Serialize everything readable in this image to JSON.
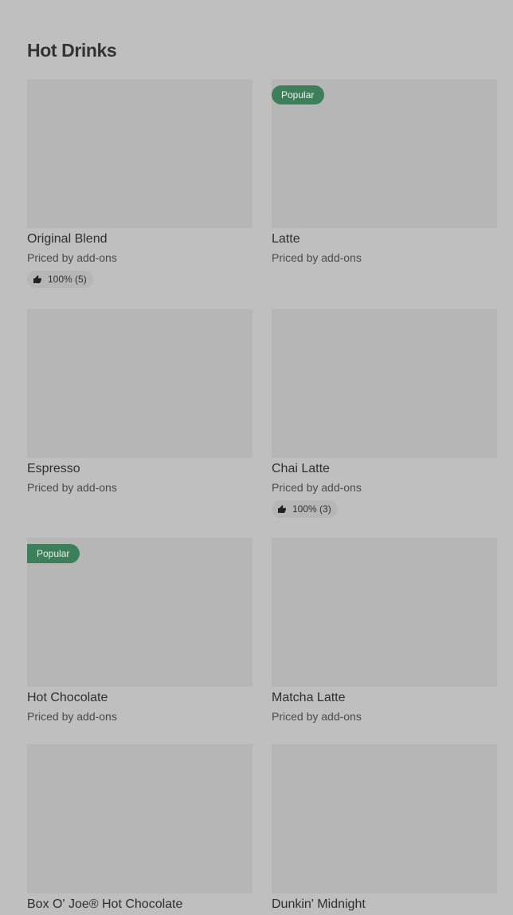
{
  "section": {
    "title": "Hot Drinks"
  },
  "items": [
    {
      "name": "Original Blend",
      "price": "Priced by add-ons",
      "badge": "",
      "rating": "100% (5)"
    },
    {
      "name": "Latte",
      "price": "Priced by add-ons",
      "badge": "Popular",
      "rating": ""
    },
    {
      "name": "Espresso",
      "price": "Priced by add-ons",
      "badge": "",
      "rating": ""
    },
    {
      "name": "Chai Latte",
      "price": "Priced by add-ons",
      "badge": "",
      "rating": "100% (3)"
    },
    {
      "name": "Hot Chocolate",
      "price": "Priced by add-ons",
      "badge": "Popular",
      "rating": ""
    },
    {
      "name": "Matcha Latte",
      "price": "Priced by add-ons",
      "badge": "",
      "rating": ""
    },
    {
      "name": "Box O' Joe® Hot Chocolate",
      "price": "",
      "badge": "",
      "rating": ""
    },
    {
      "name": "Dunkin' Midnight",
      "price": "",
      "badge": "",
      "rating": ""
    }
  ],
  "colors": {
    "background": "#bfbfbf",
    "card_image": "#b6b6b6",
    "badge": "#3e7f5b"
  },
  "icons": {
    "rating": "thumbs-up-icon"
  }
}
